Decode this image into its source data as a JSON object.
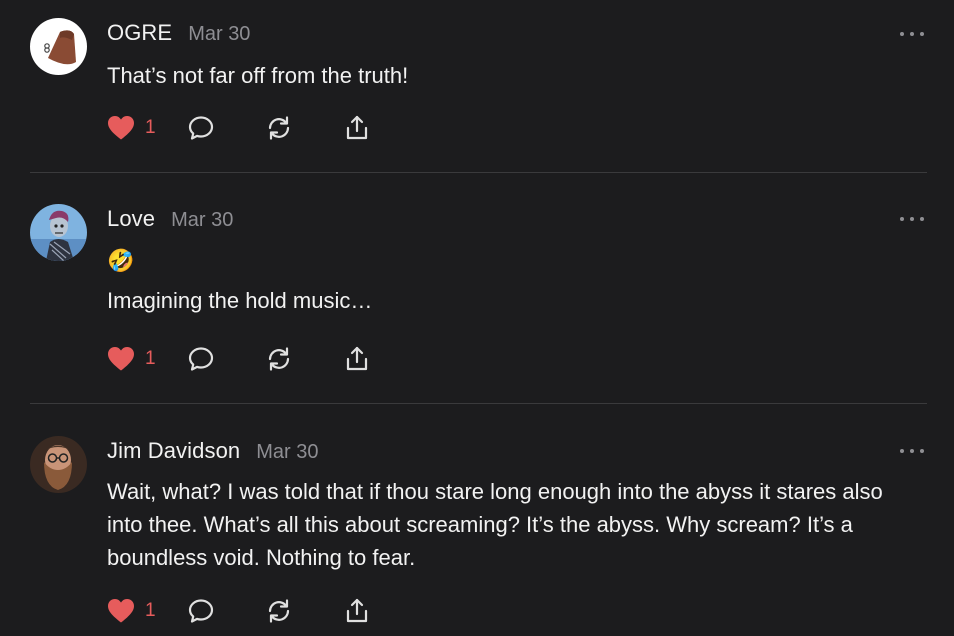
{
  "posts": [
    {
      "author": "OGRE",
      "date": "Mar 30",
      "paragraphs": [
        "That’s not far off from the truth!"
      ],
      "likes": "1",
      "avatar_icon": "ogre-avatar"
    },
    {
      "author": "Love",
      "date": "Mar 30",
      "emoji": "🤣",
      "paragraphs": [
        "Imagining the hold music…"
      ],
      "likes": "1",
      "avatar_icon": "love-avatar"
    },
    {
      "author": "Jim Davidson",
      "date": "Mar 30",
      "paragraphs": [
        "Wait, what? I was told that if thou stare long enough into the abyss it stares also into thee. What’s all this about screaming? It’s the abyss. Why scream? It’s a boundless void. Nothing to fear."
      ],
      "likes": "1",
      "avatar_icon": "jim-davidson-avatar"
    }
  ],
  "colors": {
    "background": "#1c1c1e",
    "like_red": "#e65c5c",
    "muted": "#8e8e93",
    "divider": "#3a3a3c"
  }
}
